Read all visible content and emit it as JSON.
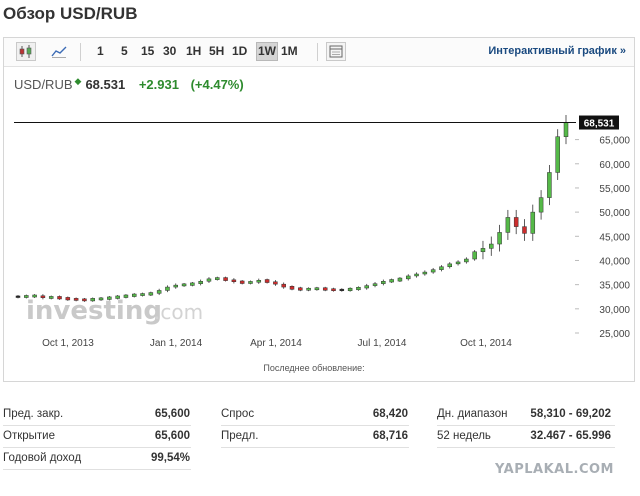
{
  "page_title": "Обзор USD/RUB",
  "toolbar": {
    "icons": [
      "candlestick-icon",
      "line-chart-icon",
      "settings-icon"
    ],
    "timeframes": [
      {
        "label": "1",
        "active": false
      },
      {
        "label": "5",
        "active": false
      },
      {
        "label": "15",
        "active": false
      },
      {
        "label": "30",
        "active": false
      },
      {
        "label": "1H",
        "active": false
      },
      {
        "label": "5H",
        "active": false
      },
      {
        "label": "1D",
        "active": false
      },
      {
        "label": "1W",
        "active": true
      },
      {
        "label": "1M",
        "active": false
      }
    ],
    "interactive_label": "Интерактивный график »"
  },
  "quote": {
    "pair": "USD/RUB",
    "price": "68.531",
    "change": "+2.931",
    "change_pct": "(+4.47%)"
  },
  "chart_data": {
    "type": "candlestick",
    "watermark": "investing.com",
    "x_tick_labels": [
      "Oct 1, 2013",
      "Jan 1, 2014",
      "Apr 1, 2014",
      "Jul 1, 2014",
      "Oct 1, 2014"
    ],
    "y_tick_labels": [
      "25,000",
      "30,000",
      "35,000",
      "40,000",
      "45,000",
      "50,000",
      "55,000",
      "60,000",
      "65,000"
    ],
    "ylim": [
      25,
      70.5
    ],
    "last_price_label": "68,531",
    "last_price": 68.531,
    "footer": "Последнее обновление:",
    "colors": {
      "up": "#55b948",
      "down": "#cc2d2d",
      "neutral": "#222222"
    },
    "candles_close": [
      32.5,
      32.6,
      32.7,
      32.3,
      32.4,
      32.2,
      32.0,
      31.9,
      31.8,
      32.0,
      32.1,
      32.3,
      32.5,
      32.7,
      32.9,
      33.0,
      33.2,
      33.8,
      34.5,
      34.9,
      35.0,
      35.2,
      35.7,
      36.2,
      36.3,
      36.0,
      35.6,
      35.4,
      35.5,
      35.9,
      35.6,
      35.1,
      34.5,
      34.2,
      34.0,
      34.1,
      34.2,
      34.0,
      33.9,
      33.9,
      34.1,
      34.3,
      34.8,
      35.2,
      35.7,
      35.9,
      36.2,
      36.8,
      37.2,
      37.6,
      38.1,
      38.7,
      39.3,
      39.7,
      40.3,
      41.8,
      42.5,
      43.4,
      45.8,
      48.9,
      47.0,
      45.6,
      50.0,
      53.0,
      58.2,
      65.6,
      68.531
    ]
  },
  "stats": {
    "rows": [
      [
        {
          "label": "Пред. закр.",
          "value": "65,600"
        },
        {
          "label": "Спрос",
          "value": "68,420"
        },
        {
          "label": "Дн. диапазон",
          "value": "58,310 - 69,202"
        }
      ],
      [
        {
          "label": "Открытие",
          "value": "65,600"
        },
        {
          "label": "Предл.",
          "value": "68,716"
        },
        {
          "label": "52 недель",
          "value": "32.467 - 65.996"
        }
      ],
      [
        {
          "label": "Годовой доход",
          "value": "99,54%"
        }
      ]
    ]
  },
  "watermark_site": "YAPLAKAL.COM"
}
